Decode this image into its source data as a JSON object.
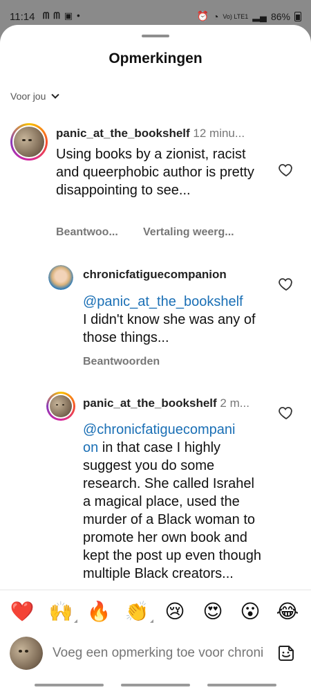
{
  "status": {
    "time": "11:14",
    "left_icons": [
      "m",
      "m",
      "image",
      "dot"
    ],
    "battery": "86%",
    "network": "Vo) LTE1"
  },
  "sheet": {
    "title": "Opmerkingen",
    "filter_label": "Voor jou"
  },
  "comments": [
    {
      "username": "panic_at_the_bookshelf",
      "time_ago": "12 minu...",
      "text": "Using books by a zionist, racist and queerphobic author is pretty disappointing to see...",
      "reply_label": "Beantwoo...",
      "translate_label": "Vertaling weerg..."
    },
    {
      "username": "chronicfatiguecompanion",
      "mention": "@panic_at_the_bookshelf",
      "text": "I didn't know she was any of those things...",
      "reply_label": "Beantwoorden"
    },
    {
      "username": "panic_at_the_bookshelf",
      "time_ago": "2 m...",
      "mention_line1": "@chronicfatiguecompani",
      "mention_line2": "on",
      "text": "in that case I highly suggest you do some research. She called Israhel a magical place, used the murder of a Black woman to promote her own book and kept the post up even though multiple Black creators..."
    }
  ],
  "reactions": [
    "❤️",
    "🙌",
    "🔥",
    "👏",
    "😢",
    "😍",
    "😮",
    "😂"
  ],
  "composer": {
    "placeholder": "Voeg een opmerking toe voor chronicfatiguecompanion..."
  }
}
